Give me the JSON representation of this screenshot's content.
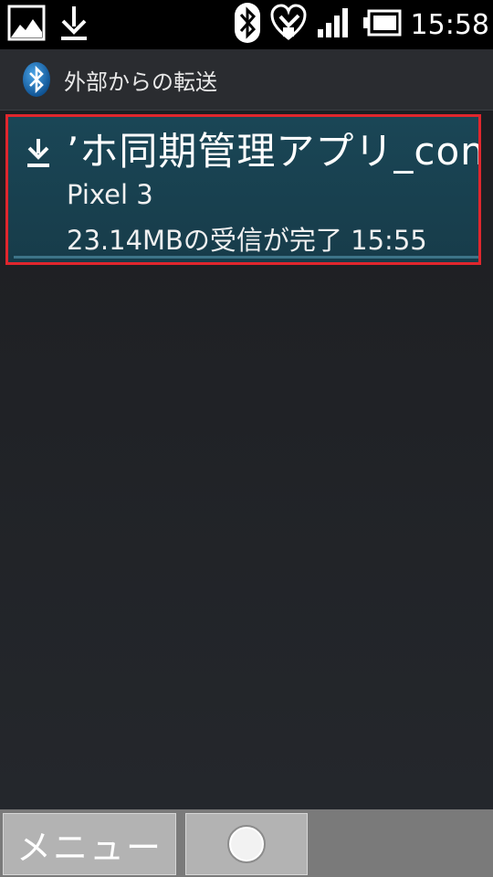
{
  "status_bar": {
    "icons": [
      "image-icon",
      "download-icon",
      "bluetooth-icon",
      "heart-care-icon",
      "signal-icon",
      "battery-icon"
    ],
    "time": "15:58"
  },
  "header": {
    "title": "外部からの転送",
    "icon": "bluetooth-icon"
  },
  "transfers": [
    {
      "icon": "download-icon",
      "filename": "’ホ同期管理アプリ_con",
      "device": "Pixel 3",
      "status": "23.14MBの受信が完了 15:55"
    }
  ],
  "bottom_bar": {
    "menu_label": "メニュー",
    "home_icon": "home-circle-icon"
  }
}
